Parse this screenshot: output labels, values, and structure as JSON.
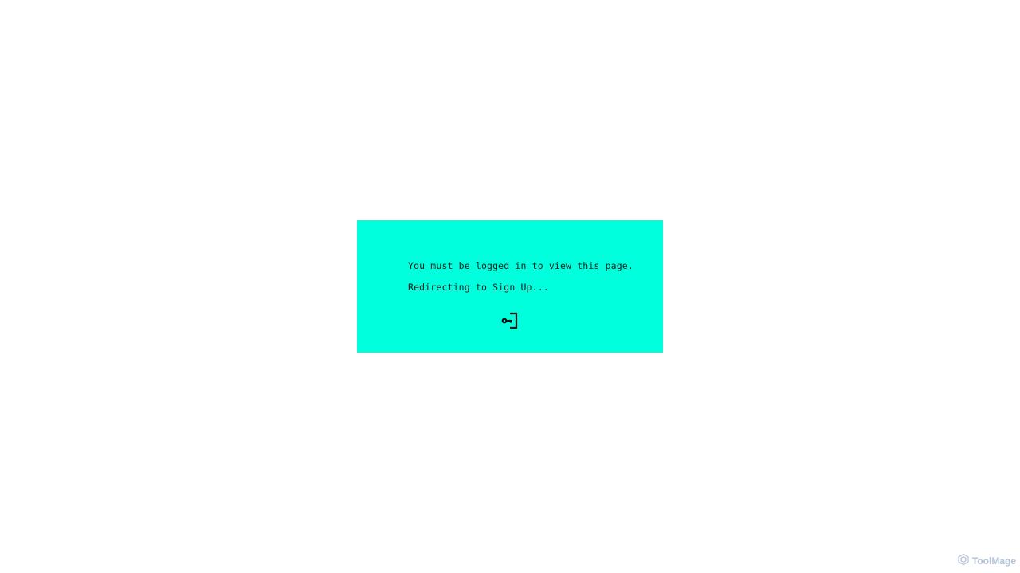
{
  "message": {
    "line1": "You must be logged in to view this page.",
    "line2": "Redirecting to Sign Up..."
  },
  "icon": "login-icon",
  "watermark": {
    "text": "ToolMage",
    "icon": "toolmage-logo-icon"
  },
  "colors": {
    "panel": "#00ffdd",
    "text": "#1a1a1a",
    "watermark": "#b3c2d6",
    "background": "#ffffff"
  }
}
